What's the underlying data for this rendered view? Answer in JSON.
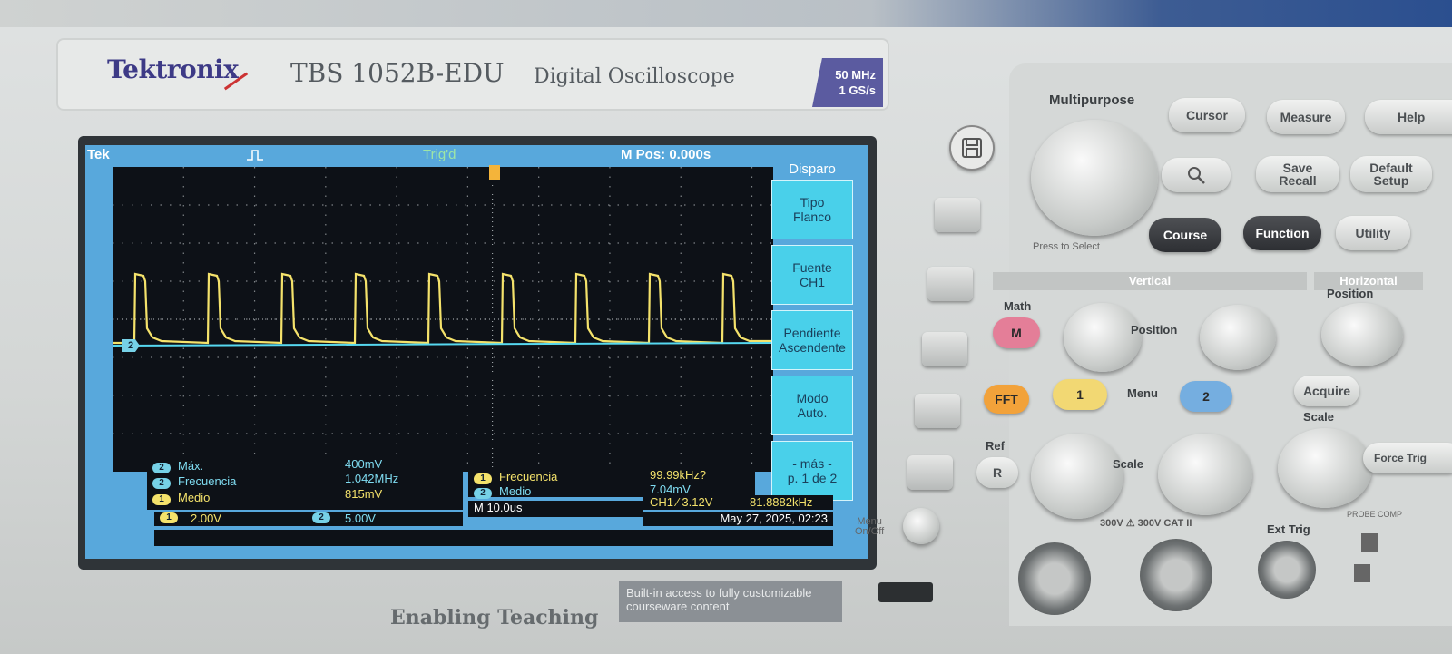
{
  "brand": {
    "name": "Tektronix",
    "model": "TBS 1052B-EDU",
    "description": "Digital Oscilloscope",
    "spec_line1": "50 MHz",
    "spec_line2": "1 GS/s"
  },
  "screen": {
    "status": {
      "logo": "Tek",
      "trigger_state": "Trig'd",
      "m_pos": "M Pos: 0.000s"
    },
    "side_menu": {
      "title": "Disparo",
      "items": [
        {
          "line1": "Tipo",
          "line2": "Flanco"
        },
        {
          "line1": "Fuente",
          "line2": "CH1"
        },
        {
          "line1": "Pendiente",
          "line2": "Ascendente"
        },
        {
          "line1": "Modo",
          "line2": "Auto."
        },
        {
          "line1": "- más -",
          "line2": "p. 1 de 2"
        }
      ]
    },
    "measurements_left": [
      {
        "channel": "2",
        "label": "Máx.",
        "value": "400mV"
      },
      {
        "channel": "2",
        "label": "Frecuencia",
        "value": "1.042MHz"
      },
      {
        "channel": "1",
        "label": "Medio",
        "value": "815mV"
      }
    ],
    "measurements_right": [
      {
        "channel": "1",
        "label": "Frecuencia",
        "value": "99.99kHz?"
      },
      {
        "channel": "2",
        "label": "Medio",
        "value": "7.04mV"
      }
    ],
    "ch1_scale": "2.00V",
    "ch2_scale": "5.00V",
    "timebase": "M 10.0us",
    "trigger_info": "CH1 ⁄ 3.12V",
    "trigger_freq": "81.8882kHz",
    "datetime": "May 27, 2025, 02:23",
    "ch2_marker": "2",
    "ch1_pulse_count": 9,
    "colors": {
      "ch1": "#f4e26b",
      "ch2": "#56d8f0",
      "background": "#0d1117",
      "chrome": "#58a8dc"
    }
  },
  "controls": {
    "multipurpose": "Multipurpose",
    "press_to_select": "Press to Select",
    "cursor": "Cursor",
    "measure": "Measure",
    "help": "Help",
    "save_recall_1": "Save",
    "save_recall_2": "Recall",
    "default_setup_1": "Default",
    "default_setup_2": "Setup",
    "course": "Course",
    "function": "Function",
    "utility": "Utility",
    "vertical": "Vertical",
    "horizontal": "Horizontal",
    "math": "Math",
    "math_btn": "M",
    "position": "Position",
    "fft": "FFT",
    "ch1_btn": "1",
    "menu": "Menu",
    "ch2_btn": "2",
    "ref": "Ref",
    "ref_btn": "R",
    "scale": "Scale",
    "acquire": "Acquire",
    "force_trig": "Force Trig",
    "menu_onoff_1": "Menu",
    "menu_onoff_2": "On/Off",
    "ext_trig": "Ext Trig",
    "cat_rating": "300V ⚠ 300V CAT II",
    "probe_comp": "PROBE COMP"
  },
  "footer": {
    "tagline": "Enabling Teaching",
    "builtin_line1": "Built-in access to fully customizable",
    "builtin_line2": "courseware content"
  }
}
